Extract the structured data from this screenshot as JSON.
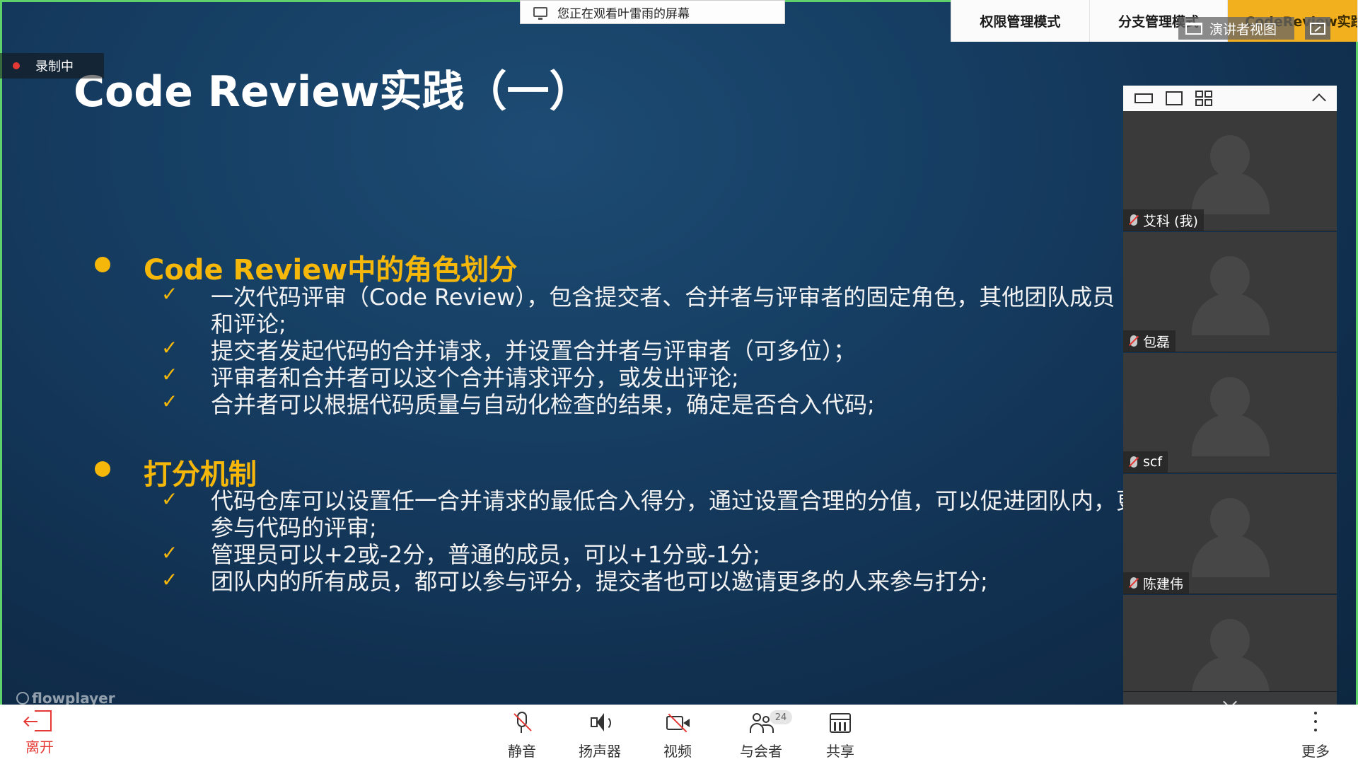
{
  "watch_banner": {
    "text": "您正在观看叶雷雨的屏幕"
  },
  "recording": {
    "label": "录制中"
  },
  "slide": {
    "title": "Code Review实践（一）",
    "sections": [
      {
        "title": "Code Review中的角色划分",
        "items": [
          "一次代码评审（Code Review），包含提交者、合并者与评审者的固定角色，其他团队成员",
          "和评论;",
          "提交者发起代码的合并请求，并设置合并者与评审者（可多位）；",
          "评审者和合并者可以这个合并请求评分，或发出评论;",
          "合并者可以根据代码质量与自动化检查的结果，确定是否合入代码;"
        ]
      },
      {
        "title": "打分机制",
        "items": [
          "代码仓库可以设置任一合并请求的最低合入得分，通过设置合理的分值，可以促进团队内，更",
          "参与代码的评审;",
          "管理员可以+2或-2分，普通的成员，可以+1分或-1分;",
          "团队内的所有成员，都可以参与评分，提交者也可以邀请更多的人来参与打分;"
        ]
      }
    ],
    "watermark": "flowplayer"
  },
  "ppt_tabs": [
    "权限管理模式",
    "分支管理模式",
    "CodeReview实践"
  ],
  "presenter_view": {
    "label": "演讲者视图"
  },
  "participants": [
    {
      "name": "艾科 (我)"
    },
    {
      "name": "包磊"
    },
    {
      "name": "scf"
    },
    {
      "name": "陈建伟"
    }
  ],
  "toolbar": {
    "leave": "离开",
    "mute": "静音",
    "speaker": "扬声器",
    "video": "视频",
    "participants": "与会者",
    "participant_count": "24",
    "share": "共享",
    "more": "更多"
  },
  "colors": {
    "accent": "#f5b80a",
    "border_green": "#5fd16a",
    "danger": "#e53935"
  }
}
